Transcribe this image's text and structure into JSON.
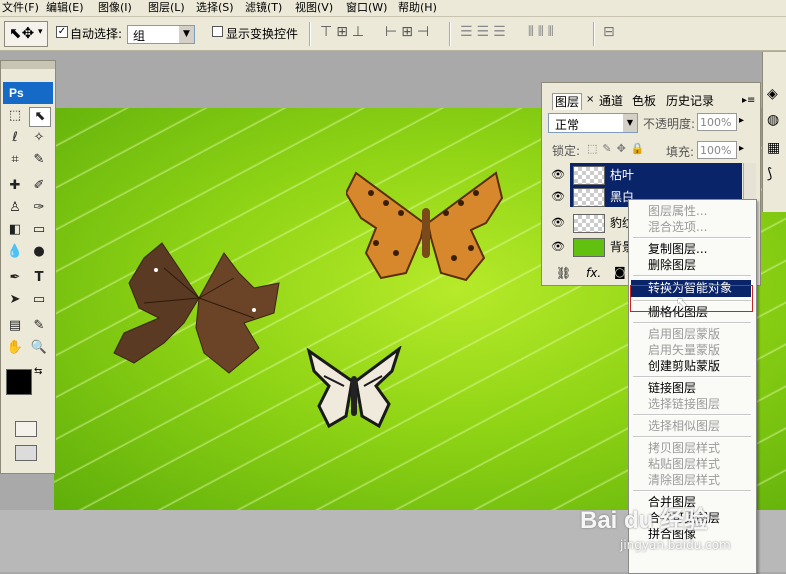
{
  "menu": [
    "文件(F)",
    "编辑(E)",
    "图像(I)",
    "图层(L)",
    "选择(S)",
    "滤镜(T)",
    "视图(V)",
    "窗口(W)",
    "帮助(H)"
  ],
  "options": {
    "auto_select_label": "自动选择:",
    "auto_select_value": "组",
    "show_transform_label": "显示变换控件"
  },
  "toolbox": {
    "logo": "Ps"
  },
  "layers_panel": {
    "tabs": [
      "图层",
      "通道",
      "色板",
      "历史记录"
    ],
    "blend_mode": "正常",
    "opacity_label": "不透明度:",
    "opacity_value": "100%",
    "lock_label": "锁定:",
    "fill_label": "填充:",
    "fill_value": "100%",
    "layers": [
      {
        "name": "枯叶",
        "selected": true
      },
      {
        "name": "黑白",
        "selected": true
      },
      {
        "name": "豹纹",
        "selected": false
      },
      {
        "name": "背景",
        "selected": false
      }
    ],
    "footer_fx": "fx."
  },
  "context_menu": {
    "items": [
      {
        "label": "图层属性...",
        "disabled": true
      },
      {
        "label": "混合选项...",
        "disabled": true
      },
      {
        "sep": true
      },
      {
        "label": "复制图层...",
        "disabled": false
      },
      {
        "label": "删除图层",
        "disabled": false
      },
      {
        "sep": true
      },
      {
        "label": "转换为智能对象",
        "disabled": false,
        "highlighted": true
      },
      {
        "sep": true
      },
      {
        "label": "栅格化图层",
        "disabled": false
      },
      {
        "sep": true
      },
      {
        "label": "启用图层蒙版",
        "disabled": true
      },
      {
        "label": "启用矢量蒙版",
        "disabled": true
      },
      {
        "label": "创建剪贴蒙版",
        "disabled": false
      },
      {
        "sep": true
      },
      {
        "label": "链接图层",
        "disabled": false
      },
      {
        "label": "选择链接图层",
        "disabled": true
      },
      {
        "sep": true
      },
      {
        "label": "选择相似图层",
        "disabled": true
      },
      {
        "sep": true
      },
      {
        "label": "拷贝图层样式",
        "disabled": true
      },
      {
        "label": "粘贴图层样式",
        "disabled": true
      },
      {
        "label": "清除图层样式",
        "disabled": true
      },
      {
        "sep": true
      },
      {
        "label": "合并图层",
        "disabled": false
      },
      {
        "label": "合并可见图层",
        "disabled": false
      },
      {
        "label": "拼合图像",
        "disabled": false
      }
    ]
  },
  "watermark": {
    "brand": "Bai du 经验",
    "url": "jingyan.baidu.com"
  },
  "colors": {
    "accent": "#0a246a",
    "highlight_border": "#cc2222",
    "canvas_green": "#8fd415"
  }
}
